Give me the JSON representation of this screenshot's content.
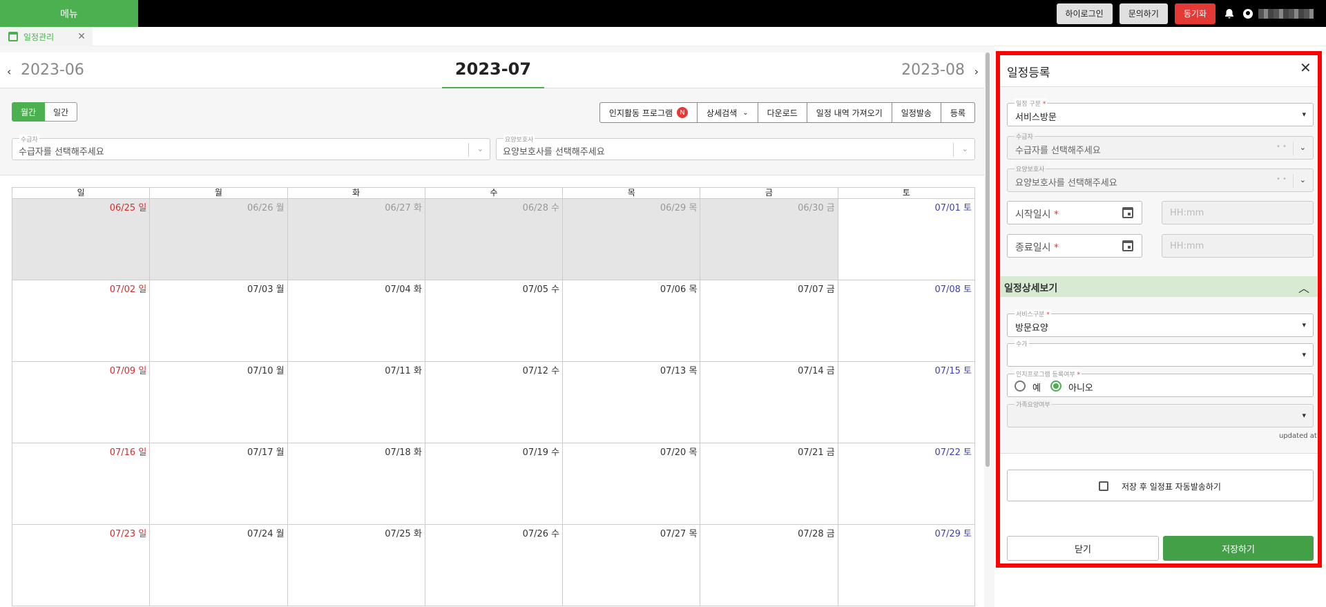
{
  "topbar": {
    "menu_label": "메뉴",
    "buttons": [
      "하이로그인",
      "문의하기",
      "동기화"
    ]
  },
  "tabs": [
    {
      "label": "일정관리"
    }
  ],
  "month_nav": {
    "prev": "2023-06",
    "current": "2023-07",
    "next": "2023-08"
  },
  "view_toggle": {
    "monthly": "월간",
    "weekly": "일간"
  },
  "actions": {
    "cognitive": "인지활동 프로그램",
    "badge": "N",
    "search": "상세검색",
    "download": "다운로드",
    "import": "일정 내역 가져오기",
    "send": "일정발송",
    "register": "등록"
  },
  "filters": {
    "recipient": {
      "label": "수급자",
      "placeholder": "수급자를 선택해주세요"
    },
    "caregiver": {
      "label": "요양보호사",
      "placeholder": "요양보호사를 선택해주세요"
    }
  },
  "calendar": {
    "weekdays": [
      "일",
      "월",
      "화",
      "수",
      "목",
      "금",
      "토"
    ],
    "weeks": [
      [
        "06/25 일",
        "06/26 월",
        "06/27 화",
        "06/28 수",
        "06/29 목",
        "06/30 금",
        "07/01 토"
      ],
      [
        "07/02 일",
        "07/03 월",
        "07/04 화",
        "07/05 수",
        "07/06 목",
        "07/07 금",
        "07/08 토"
      ],
      [
        "07/09 일",
        "07/10 월",
        "07/11 화",
        "07/12 수",
        "07/13 목",
        "07/14 금",
        "07/15 토"
      ],
      [
        "07/16 일",
        "07/17 월",
        "07/18 화",
        "07/19 수",
        "07/20 목",
        "07/21 금",
        "07/22 토"
      ],
      [
        "07/23 일",
        "07/24 월",
        "07/25 화",
        "07/26 수",
        "07/27 목",
        "07/28 금",
        "07/29 토"
      ]
    ],
    "past_days": 6
  },
  "panel": {
    "title": "일정등록",
    "schedule_type": {
      "label": "일정 구분",
      "req": "*",
      "value": "서비스방문"
    },
    "recipient": {
      "label": "수급자",
      "placeholder": "수급자를 선택해주세요"
    },
    "caregiver": {
      "label": "요양보호사",
      "placeholder": "요양보호사를 선택해주세요"
    },
    "start": {
      "label": "시작일시",
      "req": "*",
      "time_placeholder": "HH:mm"
    },
    "end": {
      "label": "종료일시",
      "req": "*",
      "time_placeholder": "HH:mm"
    },
    "detail_section": "일정상세보기",
    "service_type": {
      "label": "서비스구분",
      "req": "*",
      "value": "방문요양"
    },
    "fee": {
      "label": "수가"
    },
    "cognitive_reg": {
      "label": "인지프로그램 등록여부",
      "req": "*",
      "yes": "예",
      "no": "아니오",
      "selected": "아니오"
    },
    "family_care": {
      "label": "가족요양여부"
    },
    "updated_at": "updated at",
    "auto_send": "저장 후 일정표 자동발송하기",
    "close_btn": "닫기",
    "save_btn": "저장하기"
  },
  "colors": {
    "accent": "#4caf50",
    "danger": "#e53935",
    "highlight_border": "#ff0000",
    "sunday": "#d32f2f",
    "saturday": "#3f3fb0"
  }
}
